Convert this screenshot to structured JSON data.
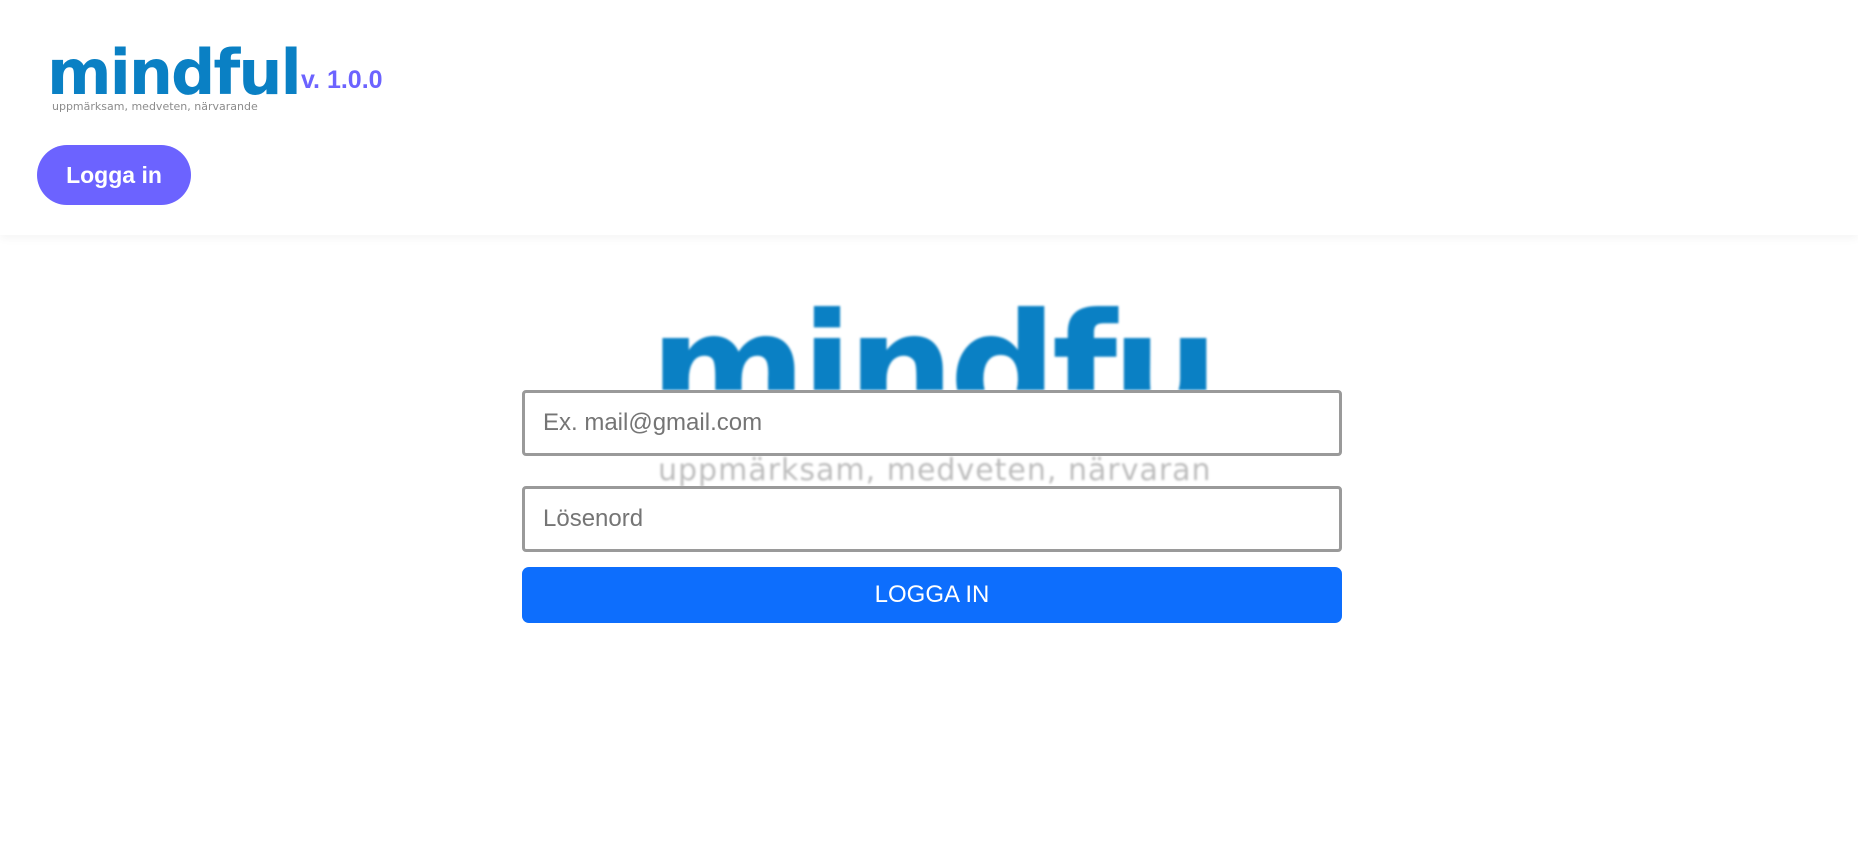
{
  "header": {
    "logo": {
      "word": "mindful",
      "tagline": "uppmärksam, medveten, närvarande"
    },
    "version": "v. 1.0.0",
    "login_button": "Logga in"
  },
  "hero": {
    "logo": {
      "word": "mindful",
      "tagline": "uppmärksam, medveten, närvarande"
    }
  },
  "login_form": {
    "email_placeholder": "Ex. mail@gmail.com",
    "email_value": "",
    "password_placeholder": "Lösenord",
    "password_value": "",
    "submit_label": "LOGGA IN"
  },
  "colors": {
    "brand_blue": "#0a80c4",
    "accent_purple": "#6c63ff",
    "primary_button": "#0d6efd"
  }
}
